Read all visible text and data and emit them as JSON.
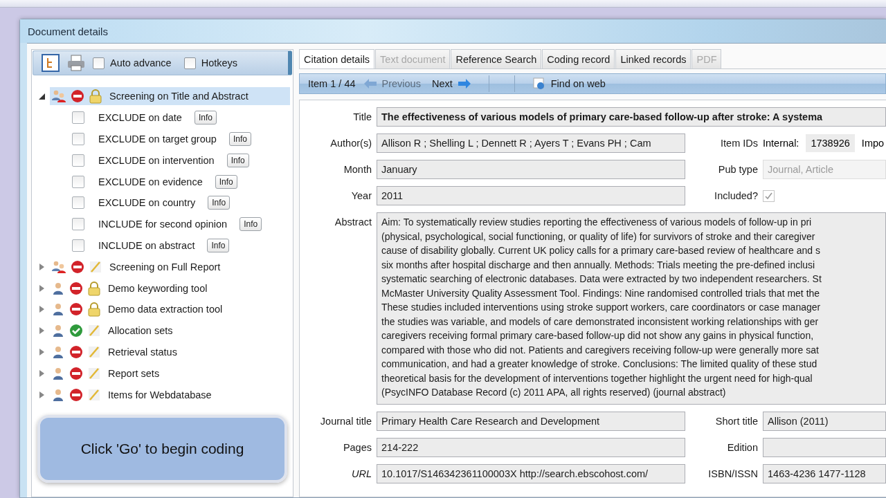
{
  "window": {
    "title": "Document details"
  },
  "toolbar": {
    "checkboxes": [
      {
        "label": "Auto advance",
        "checked": false
      },
      {
        "label": "Hotkeys",
        "checked": false
      }
    ]
  },
  "tree": [
    {
      "label": "Screening on Title and Abstract",
      "expanded": true,
      "selected": true,
      "multi_user": true,
      "completed": false,
      "locked": true,
      "children": [
        {
          "label": "EXCLUDE on date",
          "checked": false,
          "button": "Info"
        },
        {
          "label": "EXCLUDE on target group",
          "checked": false,
          "button": "Info"
        },
        {
          "label": "EXCLUDE on intervention",
          "checked": false,
          "button": "Info"
        },
        {
          "label": "EXCLUDE on evidence",
          "checked": false,
          "button": "Info"
        },
        {
          "label": "EXCLUDE on country",
          "checked": false,
          "button": "Info"
        },
        {
          "label": "INCLUDE for second opinion",
          "checked": false,
          "button": "Info"
        },
        {
          "label": "INCLUDE on abstract",
          "checked": false,
          "button": "Info"
        }
      ]
    },
    {
      "label": "Screening on Full Report",
      "expanded": false,
      "selected": false,
      "multi_user": true,
      "completed": false,
      "locked": false
    },
    {
      "label": "Demo keywording tool",
      "expanded": false,
      "selected": false,
      "multi_user": false,
      "completed": false,
      "locked": true
    },
    {
      "label": "Demo data extraction tool",
      "expanded": false,
      "selected": false,
      "multi_user": false,
      "completed": false,
      "locked": true
    },
    {
      "label": "Allocation sets",
      "expanded": false,
      "selected": false,
      "multi_user": false,
      "completed": true,
      "locked": false
    },
    {
      "label": "Retrieval status",
      "expanded": false,
      "selected": false,
      "multi_user": false,
      "completed": false,
      "locked": false
    },
    {
      "label": "Report sets",
      "expanded": false,
      "selected": false,
      "multi_user": false,
      "completed": false,
      "locked": false
    },
    {
      "label": "Items for Webdatabase",
      "expanded": false,
      "selected": false,
      "multi_user": false,
      "completed": false,
      "locked": false
    }
  ],
  "tabs": [
    {
      "label": "Citation details",
      "selected": true,
      "disabled": false
    },
    {
      "label": "Text document",
      "selected": false,
      "disabled": true
    },
    {
      "label": "Reference Search",
      "selected": false,
      "disabled": false
    },
    {
      "label": "Coding record",
      "selected": false,
      "disabled": false
    },
    {
      "label": "Linked records",
      "selected": false,
      "disabled": false
    },
    {
      "label": "PDF",
      "selected": false,
      "disabled": true
    }
  ],
  "navigation": {
    "position": "Item 1 / 44",
    "previous": {
      "label": "Previous",
      "disabled": true
    },
    "next": {
      "label": "Next",
      "disabled": false
    },
    "find": "Find on web"
  },
  "citation": {
    "title_label": "Title",
    "title": "The effectiveness of various models of primary care-based follow-up after stroke: A systema",
    "authors_label": "Author(s)",
    "authors": "Allison R ; Shelling L ; Dennett R ; Ayers T ; Evans PH ; Cam",
    "item_ids_label": "Item IDs",
    "internal_label": "Internal:",
    "internal": "1738926",
    "cut_label": "Impo",
    "month_label": "Month",
    "month": "January",
    "pub_type_label": "Pub type",
    "pub_type": "Journal, Article",
    "year_label": "Year",
    "year": "2011",
    "included_label": "Included?",
    "included": true,
    "abstract_label": "Abstract",
    "abstract_lines": [
      "Aim: To systematically review studies reporting the effectiveness of various models of follow-up in pri",
      "(physical, psychological, social functioning, or quality of life) for survivors of stroke and their caregiver",
      "cause of disability globally. Current UK policy calls for a primary care-based review of healthcare and s",
      "six months after hospital discharge and then annually. Methods: Trials meeting the pre-defined inclusi",
      "systematic searching of electronic databases. Data were extracted by two independent researchers. St",
      "McMaster University Quality Assessment Tool. Findings: Nine randomised controlled trials that met the",
      "These studies included interventions using stroke support workers, care coordinators or case manager",
      "the studies was variable, and models of care demonstrated inconsistent working relationships with ger",
      "caregivers receiving formal primary care-based follow-up did not show any gains in physical function,",
      "compared with those who did not. Patients and caregivers receiving follow-up were generally more sat",
      "communication, and had a greater knowledge of stroke. Conclusions: The limited quality of these stud",
      "theoretical basis for the development of interventions together highlight the urgent need for high-qual",
      "(PsycINFO Database Record (c) 2011 APA, all rights reserved) (journal abstract)"
    ],
    "journal_label": "Journal title",
    "journal": "Primary Health Care Research and Development",
    "short_title_label": "Short title",
    "short_title": "Allison (2011)",
    "pages_label": "Pages",
    "pages": "214-222",
    "edition_label": "Edition",
    "url_label": "URL",
    "url": "10.1017/S146342361100003X http://search.ebscohost.com/",
    "isbn_label": "ISBN/ISSN",
    "isbn": "1463-4236 1477-1128"
  },
  "overlay": {
    "message": "Click 'Go' to begin coding"
  }
}
